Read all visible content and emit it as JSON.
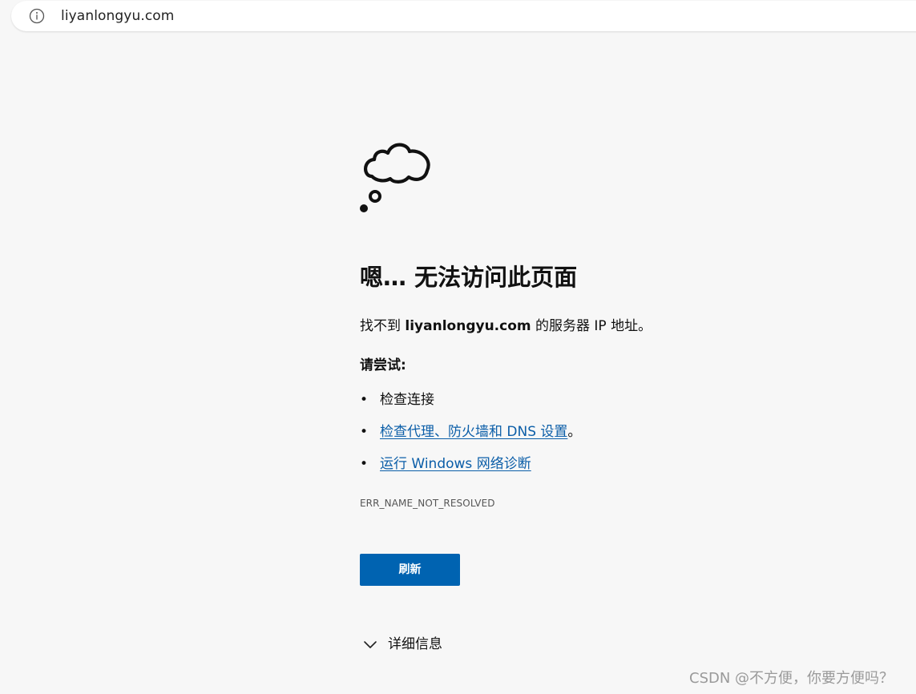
{
  "browser": {
    "url": "liyanlongyu.com",
    "icons": {
      "site_info": "info-circle-icon"
    }
  },
  "error_page": {
    "illustration": "thought-cloud-icon",
    "title": "嗯… 无法访问此页面",
    "message_prefix": "找不到 ",
    "host": "liyanlongyu.com",
    "message_suffix": " 的服务器 IP 地址。",
    "try_label": "请尝试:",
    "suggestions": [
      {
        "text": "检查连接",
        "is_link": false,
        "suffix": ""
      },
      {
        "text": "检查代理、防火墙和 DNS 设置",
        "is_link": true,
        "suffix": "。"
      },
      {
        "text": "运行 Windows 网络诊断",
        "is_link": true,
        "suffix": ""
      }
    ],
    "error_code": "ERR_NAME_NOT_RESOLVED",
    "refresh_label": "刷新",
    "details_label": "详细信息",
    "details_icon": "chevron-down-icon"
  },
  "watermark": "CSDN @不方便，你要方便吗？",
  "colors": {
    "background": "#f7f7f7",
    "link": "#0b5ea8",
    "button": "#0063b1",
    "button_text": "#ffffff",
    "text": "#111111",
    "muted": "#555555"
  }
}
